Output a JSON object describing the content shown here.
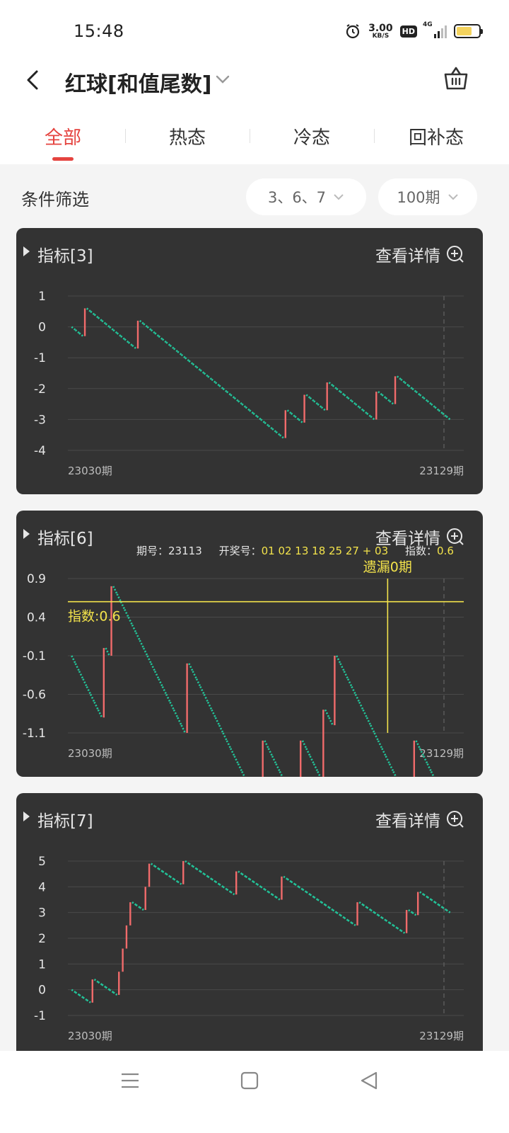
{
  "status_bar": {
    "time": "15:48",
    "speed_value": "3.00",
    "speed_unit": "KB/S",
    "hd": "HD",
    "network": "4G",
    "icons": [
      "alarm-icon",
      "hd-icon",
      "signal-icon",
      "battery-icon"
    ],
    "battery_level": 0.7
  },
  "header": {
    "title": "红球[和值尾数]"
  },
  "tabs": [
    {
      "label": "全部",
      "active": true
    },
    {
      "label": "热态",
      "active": false
    },
    {
      "label": "冷态",
      "active": false
    },
    {
      "label": "回补态",
      "active": false
    }
  ],
  "filter": {
    "label": "条件筛选",
    "numbers_value": "3、6、7",
    "periods_value": "100期"
  },
  "colors": {
    "accent": "#e5433f",
    "card_bg": "#333333",
    "up": "#f16b6b",
    "down": "#22c59a",
    "highlight": "#f3e34b"
  },
  "cards": [
    {
      "title": "指标[3]",
      "detail_label": "查看详情",
      "x_start": "23030期",
      "x_end": "23129期"
    },
    {
      "title": "指标[6]",
      "detail_label": "查看详情",
      "x_start": "23030期",
      "x_end": "23129期",
      "tooltip": {
        "period_label": "期号：",
        "period": "23113",
        "draw_label": "开奖号：",
        "draw": "01 02 13 18 25 27 + 03",
        "index_label": "指数：",
        "index": "0.6",
        "miss_label": "遗漏0期",
        "ref_label": "指数:0.6"
      }
    },
    {
      "title": "指标[7]",
      "detail_label": "查看详情",
      "x_start": "23030期",
      "x_end": "23129期"
    }
  ],
  "chart_data": [
    {
      "type": "line",
      "title": "指标[3]",
      "y_ticks": [
        "1",
        "0",
        "-1",
        "-2",
        "-3",
        "-4"
      ],
      "ylim": [
        -4,
        1
      ],
      "x_range": [
        "23030期",
        "23129期"
      ],
      "grid": true,
      "up_step": 0.9,
      "down_step": 0.1,
      "start": 0,
      "up_at": [
        3,
        17,
        56,
        61,
        67,
        80,
        85
      ]
    },
    {
      "type": "line",
      "title": "指标[6]",
      "y_ticks": [
        "0.9",
        "0.4",
        "-0.1",
        "-0.6",
        "-1.1"
      ],
      "ylim": [
        -1.1,
        0.9
      ],
      "x_range": [
        "23030期",
        "23129期"
      ],
      "grid": true,
      "up_step": 0.9,
      "down_step": 0.1,
      "start": -0.1,
      "up_at": [
        8,
        10,
        30,
        50,
        60,
        66,
        69,
        90
      ],
      "crosshair_period": "23113",
      "crosshair_value": 0.6
    },
    {
      "type": "line",
      "title": "指标[7]",
      "y_ticks": [
        "5",
        "4",
        "3",
        "2",
        "1",
        "0",
        "-1"
      ],
      "ylim": [
        -1,
        5
      ],
      "x_range": [
        "23030期",
        "23129期"
      ],
      "grid": true,
      "up_step": 0.9,
      "down_step": 0.1,
      "start": 0,
      "up_at": [
        5,
        12,
        13,
        14,
        15,
        19,
        20,
        29,
        43,
        55,
        75,
        88,
        91
      ]
    }
  ],
  "nav": {
    "icons": [
      "menu-icon",
      "home-icon",
      "back-nav-icon"
    ]
  }
}
